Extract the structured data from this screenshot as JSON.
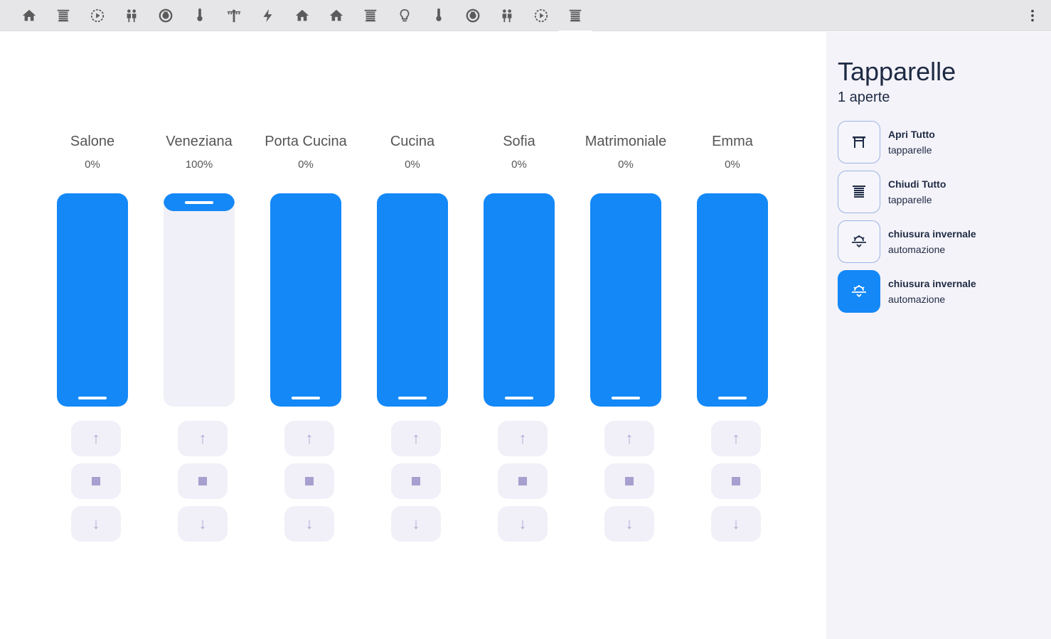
{
  "toolbar": {
    "tabs": [
      {
        "icon": "home-icon"
      },
      {
        "icon": "blinds-icon"
      },
      {
        "icon": "play-circle-icon"
      },
      {
        "icon": "people-icon"
      },
      {
        "icon": "robot-vacuum-icon"
      },
      {
        "icon": "thermometer-icon"
      },
      {
        "icon": "string-lights-icon"
      },
      {
        "icon": "lightning-icon"
      },
      {
        "icon": "home-icon"
      },
      {
        "icon": "home-icon"
      },
      {
        "icon": "blinds-icon"
      },
      {
        "icon": "lightbulb-icon"
      },
      {
        "icon": "thermometer-icon"
      },
      {
        "icon": "robot-vacuum-icon"
      },
      {
        "icon": "people-icon"
      },
      {
        "icon": "play-circle-icon"
      },
      {
        "icon": "blinds-icon",
        "active": true
      }
    ],
    "menu_icon": "dots-vertical-icon"
  },
  "shutters": [
    {
      "name": "Salone",
      "percent_label": "0%",
      "open_fraction": 0
    },
    {
      "name": "Veneziana",
      "percent_label": "100%",
      "open_fraction": 1
    },
    {
      "name": "Porta Cucina",
      "percent_label": "0%",
      "open_fraction": 0
    },
    {
      "name": "Cucina",
      "percent_label": "0%",
      "open_fraction": 0
    },
    {
      "name": "Sofia",
      "percent_label": "0%",
      "open_fraction": 0
    },
    {
      "name": "Matrimoniale",
      "percent_label": "0%",
      "open_fraction": 0
    },
    {
      "name": "Emma",
      "percent_label": "0%",
      "open_fraction": 0
    }
  ],
  "controls": {
    "up": "↑",
    "down": "↓"
  },
  "sidebar": {
    "title": "Tapparelle",
    "subtitle": "1 aperte",
    "actions": [
      {
        "label": "Apri Tutto",
        "sub": "tapparelle",
        "icon": "blinds-open-icon",
        "active": false
      },
      {
        "label": "Chiudi Tutto",
        "sub": "tapparelle",
        "icon": "blinds-closed-icon",
        "active": false
      },
      {
        "label": "chiusura invernale",
        "sub": "automazione",
        "icon": "sun-snowflake-icon",
        "active": false
      },
      {
        "label": "chiusura invernale",
        "sub": "automazione",
        "icon": "sun-snowflake-icon",
        "active": true
      }
    ]
  },
  "colors": {
    "accent": "#1488f7",
    "icon": "#5b5b5b",
    "dark_text": "#1e2a44"
  }
}
